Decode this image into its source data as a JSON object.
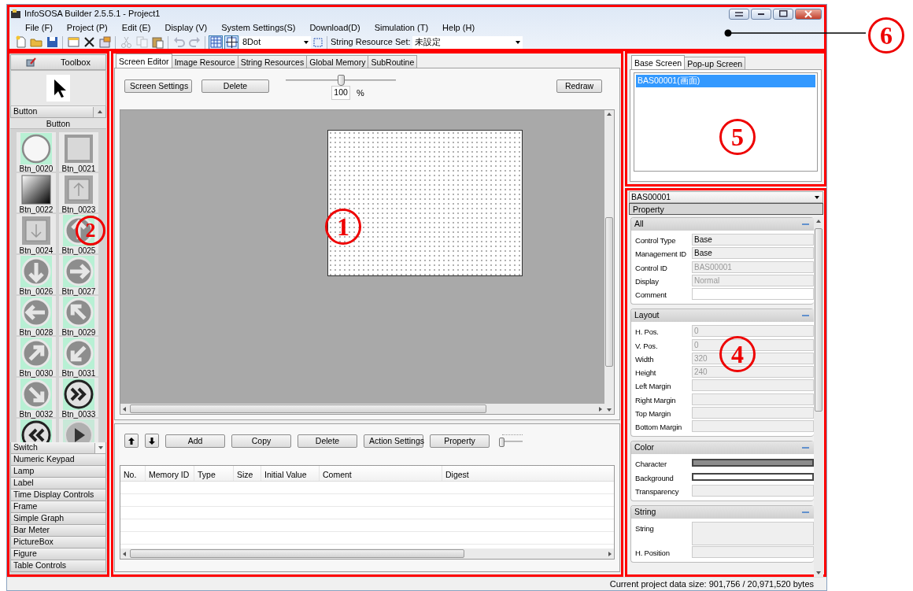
{
  "window": {
    "title": "InfoSOSA Builder 2.5.5.1 - Project1"
  },
  "menu": [
    "File (F)",
    "Project (P)",
    "Edit (E)",
    "Display (V)",
    "System Settings(S)",
    "Download(D)",
    "Simulation (T)",
    "Help (H)"
  ],
  "toolbar": {
    "buttons": [
      {
        "kind": "new",
        "disabled": false,
        "pressed": false
      },
      {
        "kind": "open",
        "disabled": false,
        "pressed": false
      },
      {
        "kind": "save",
        "disabled": false,
        "pressed": false
      },
      {
        "kind": "screen",
        "disabled": false,
        "pressed": false
      },
      {
        "kind": "delete",
        "disabled": false,
        "pressed": false
      },
      {
        "kind": "properties",
        "disabled": false,
        "pressed": false
      },
      {
        "kind": "cut",
        "disabled": true,
        "pressed": false
      },
      {
        "kind": "copy",
        "disabled": true,
        "pressed": false
      },
      {
        "kind": "paste",
        "disabled": false,
        "pressed": false
      },
      {
        "kind": "undo",
        "disabled": true,
        "pressed": false
      },
      {
        "kind": "redo",
        "disabled": true,
        "pressed": false
      },
      {
        "kind": "grid",
        "disabled": false,
        "pressed": true
      },
      {
        "kind": "fit",
        "disabled": false,
        "pressed": true
      }
    ],
    "dot_size": "8Dot",
    "resource_label": "String Resource Set:",
    "resource_set": "未設定"
  },
  "toolbox": {
    "title": "Toolbox",
    "category": "Button",
    "group": "Button",
    "items": [
      {
        "label": "Btn_0020",
        "kind": "round-plain"
      },
      {
        "label": "Btn_0021",
        "kind": "square-plain"
      },
      {
        "label": "Btn_0022",
        "kind": "gradient"
      },
      {
        "label": "Btn_0023",
        "kind": "square-up"
      },
      {
        "label": "Btn_0024",
        "kind": "square-down"
      },
      {
        "label": "Btn_0025",
        "kind": "round-up"
      },
      {
        "label": "Btn_0026",
        "kind": "round-down"
      },
      {
        "label": "Btn_0027",
        "kind": "round-right"
      },
      {
        "label": "Btn_0028",
        "kind": "round-left"
      },
      {
        "label": "Btn_0029",
        "kind": "round-upleft"
      },
      {
        "label": "Btn_0030",
        "kind": "round-upright"
      },
      {
        "label": "Btn_0031",
        "kind": "round-downleft"
      },
      {
        "label": "Btn_0032",
        "kind": "round-downright"
      },
      {
        "label": "Btn_0033",
        "kind": "double-right"
      },
      {
        "kind": "double-left"
      },
      {
        "kind": "play"
      }
    ],
    "categories": [
      "Switch",
      "Numeric Keypad",
      "Lamp",
      "Label",
      "Time Display Controls",
      "Frame",
      "Simple Graph",
      "Bar Meter",
      "PictureBox",
      "Figure",
      "Table Controls"
    ]
  },
  "editor": {
    "tabs": [
      {
        "label": "Screen Editor",
        "selected": true
      },
      {
        "label": "Image Resource",
        "selected": false
      },
      {
        "label": "String Resources",
        "selected": false
      },
      {
        "label": "Global Memory",
        "selected": false
      },
      {
        "label": "SubRoutine",
        "selected": false
      }
    ],
    "buttons": [
      "Screen Settings",
      "Delete"
    ],
    "zoom": {
      "level": 0.5,
      "value": "100",
      "unit": "%"
    },
    "redraw": "Redraw"
  },
  "memory": {
    "buttons": [
      "Add",
      "Copy",
      "Delete",
      "Action Settings",
      "Property"
    ],
    "slider": {
      "level": 0
    },
    "columns": [
      "No.",
      "Memory ID",
      "Type",
      "Size",
      "Initial Value",
      "Coment",
      "Digest"
    ]
  },
  "screens": {
    "tabs": [
      {
        "label": "Base Screen",
        "selected": true
      },
      {
        "label": "Pop-up Screen",
        "selected": false
      }
    ],
    "items": [
      {
        "label": "BAS00001(画面)",
        "selected": true
      }
    ]
  },
  "properties": {
    "object": "BAS00001",
    "header": "Property",
    "groups": [
      {
        "title": "All",
        "expanded": true,
        "rows": [
          {
            "label": "Control Type",
            "kind": "text",
            "value": "Base",
            "disabled": false,
            "editable": false
          },
          {
            "label": "Management ID",
            "kind": "text",
            "value": "Base",
            "disabled": false,
            "editable": false
          },
          {
            "label": "Control ID",
            "kind": "text",
            "value": "BAS00001",
            "disabled": true,
            "editable": false
          },
          {
            "label": "Display",
            "kind": "text",
            "value": "Normal",
            "disabled": true,
            "editable": false
          },
          {
            "label": "Comment",
            "kind": "text",
            "disabled": false,
            "editable": true
          }
        ]
      },
      {
        "title": "Layout",
        "expanded": true,
        "rows": [
          {
            "label": "H. Pos.",
            "kind": "text",
            "value": "0",
            "disabled": true,
            "editable": false
          },
          {
            "label": "V. Pos.",
            "kind": "text",
            "value": "0",
            "disabled": true,
            "editable": false
          },
          {
            "label": "Width",
            "kind": "text",
            "value": "320",
            "disabled": true,
            "editable": false
          },
          {
            "label": "Height",
            "kind": "text",
            "value": "240",
            "disabled": true,
            "editable": false
          },
          {
            "label": "Left Margin",
            "kind": "text",
            "disabled": true,
            "editable": false
          },
          {
            "label": "Right Margin",
            "kind": "text",
            "disabled": true,
            "editable": false
          },
          {
            "label": "Top Margin",
            "kind": "text",
            "disabled": true,
            "editable": false
          },
          {
            "label": "Bottom Margin",
            "kind": "text",
            "disabled": true,
            "editable": false
          }
        ]
      },
      {
        "title": "Color",
        "expanded": true,
        "rows": [
          {
            "label": "Character",
            "kind": "color",
            "color": "#8c8c8c"
          },
          {
            "label": "Background",
            "kind": "color",
            "color": "#ffffff"
          },
          {
            "label": "Transparency",
            "kind": "text",
            "disabled": false,
            "editable": false
          }
        ]
      },
      {
        "title": "String",
        "expanded": true,
        "rows": [
          {
            "label": "String",
            "kind": "textarea",
            "disabled": false,
            "editable": false
          },
          {
            "label": "H. Position",
            "kind": "text",
            "disabled": false,
            "editable": false
          }
        ]
      }
    ]
  },
  "status_bar": "Current project data size: 901,756 / 20,971,520 bytes",
  "callouts": [
    {
      "label": "1"
    },
    {
      "label": "2"
    },
    {
      "label": "4"
    },
    {
      "label": "5"
    },
    {
      "label": "6"
    }
  ]
}
